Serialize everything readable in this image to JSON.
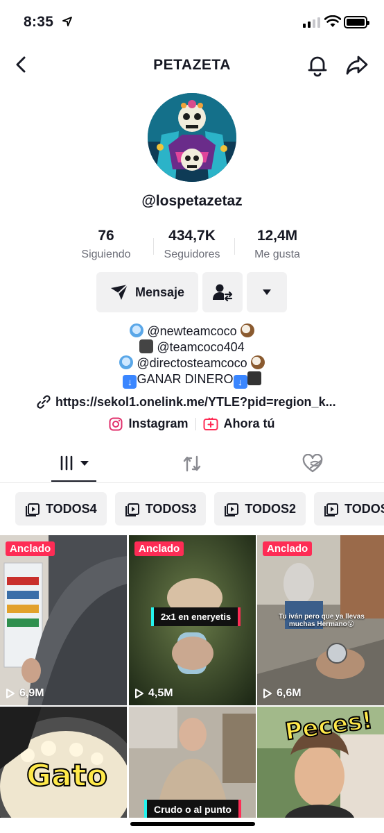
{
  "status_bar": {
    "time": "8:35"
  },
  "nav": {
    "title": "PETAZETA"
  },
  "profile": {
    "handle": "@lospetazetaz",
    "stats": [
      {
        "value": "76",
        "label": "Siguiendo"
      },
      {
        "value": "434,7K",
        "label": "Seguidores"
      },
      {
        "value": "12,4M",
        "label": "Me gusta"
      }
    ],
    "message_button": "Mensaje",
    "bio": {
      "line1": "@newteamcoco",
      "line2": "@teamcoco404",
      "line3": "@directosteamcoco",
      "line4": "GANAR DINERO"
    },
    "link": "https://sekol1.onelink.me/YTLE?pid=region_k...",
    "socials": {
      "instagram": "Instagram",
      "ahora_tu": "Ahora tú"
    }
  },
  "playlists": [
    "TODOS4",
    "TODOS3",
    "TODOS2",
    "TODOS"
  ],
  "videos": [
    {
      "pinned": "Anclado",
      "views": "6,9M"
    },
    {
      "pinned": "Anclado",
      "views": "4,5M",
      "caption": "2x1 en eneryetis"
    },
    {
      "pinned": "Anclado",
      "views": "6,6M",
      "caption": "Tu iván pero que ya llevas muchas Hermano😮"
    },
    {
      "caption": "Gato"
    },
    {
      "caption": "Crudo o al punto"
    },
    {
      "caption": "Peces!"
    }
  ],
  "colors": {
    "accent": "#fe2c55",
    "chip_bg": "#f1f1f2",
    "text": "#161823",
    "muted": "#6b6d77"
  }
}
